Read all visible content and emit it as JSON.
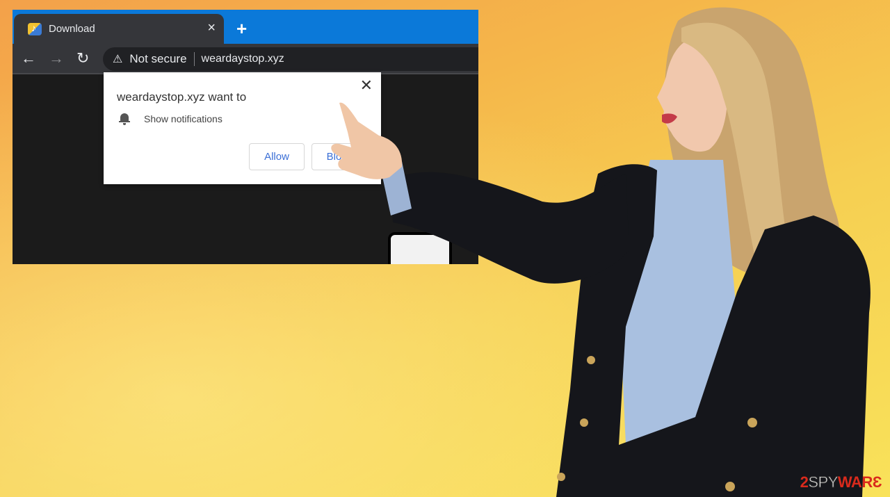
{
  "browser": {
    "tab": {
      "favicon": "music-file-icon",
      "title": "Download",
      "close_icon": "×"
    },
    "new_tab_icon": "+",
    "toolbar": {
      "back_icon": "←",
      "forward_icon": "→",
      "reload_icon": "↻",
      "warning_icon": "⚠",
      "security_label": "Not secure",
      "url": "weardaystop.xyz"
    },
    "popup": {
      "title": "weardaystop.xyz want to",
      "permission_icon": "bell-icon",
      "permission_label": "Show notifications",
      "close_icon": "✕",
      "allow_label": "Allow",
      "block_label": "Block"
    }
  },
  "logo": {
    "prefix": "2",
    "middle": "SPY",
    "suffix": "WAR",
    "end": "Ɛ"
  },
  "colors": {
    "tabstrip": "#0b79d9",
    "tab_bg": "#35363a",
    "omnibox_bg": "#202124",
    "button_text": "#3b6fd6",
    "logo_red": "#d92a1c"
  }
}
